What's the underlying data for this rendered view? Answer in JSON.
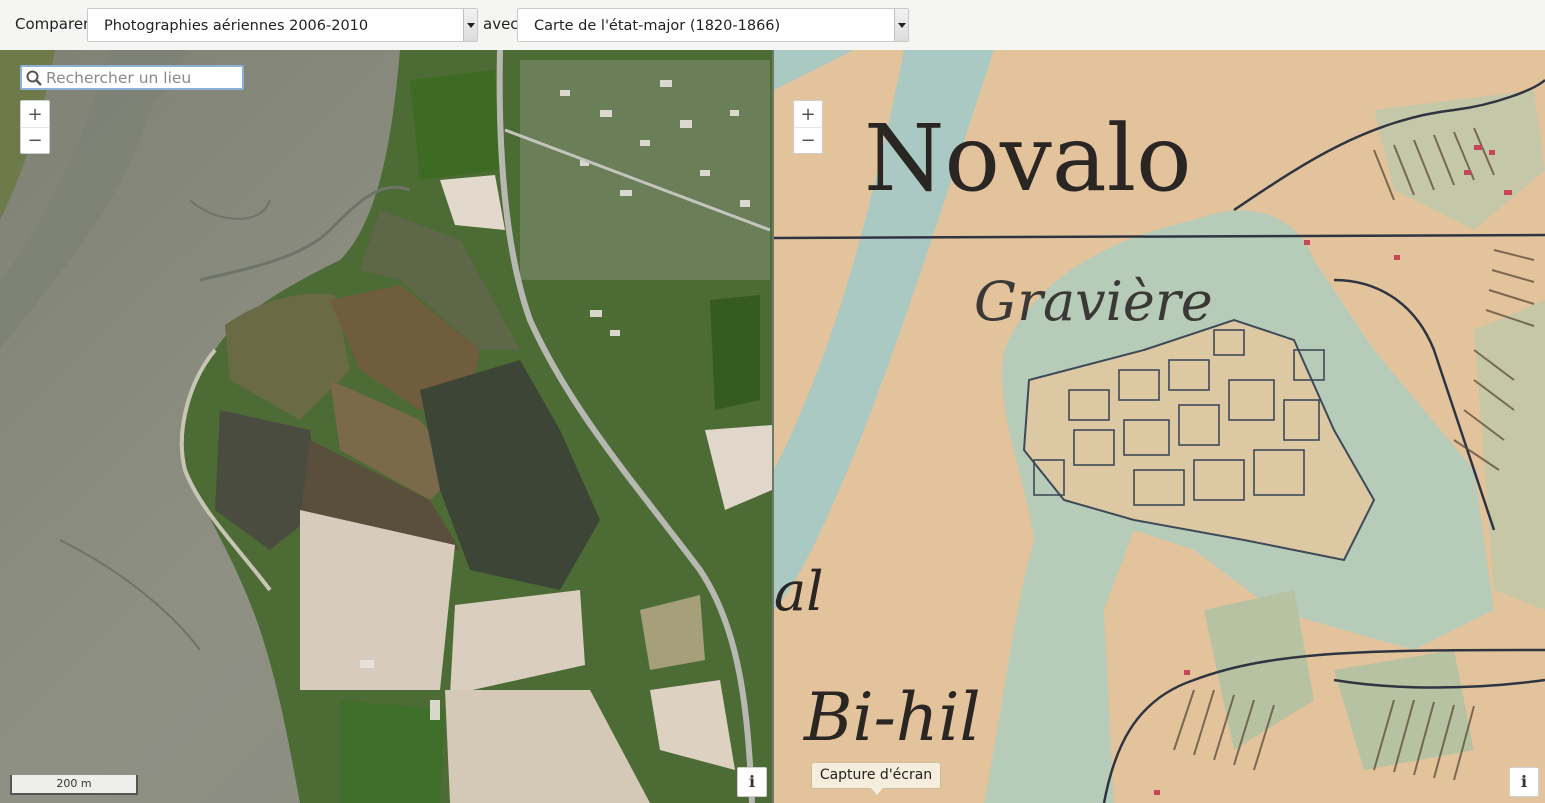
{
  "toolbar": {
    "compare_label": "Comparer",
    "left_select_value": "Photographies aériennes 2006-2010",
    "with_label": "avec",
    "right_select_value": "Carte de l'état-major (1820-1866)"
  },
  "left_map": {
    "search_placeholder": "Rechercher un lieu",
    "zoom_in": "+",
    "zoom_out": "−",
    "scale_label": "200 m",
    "info_label": "i"
  },
  "right_map": {
    "zoom_in": "+",
    "zoom_out": "−",
    "info_label": "i",
    "place_labels": [
      "Novalo",
      "Gravière",
      "Bi-hil",
      "al"
    ]
  },
  "screenshot_button": {
    "label": "Capture d'écran"
  },
  "colors": {
    "toolbar_bg": "#f5f6f3",
    "map_old_paper": "#e6c9a2",
    "map_old_water": "#9fc6c4",
    "aerial_mudflat": "#8b8d82",
    "aerial_forest": "#3f6a2c"
  }
}
